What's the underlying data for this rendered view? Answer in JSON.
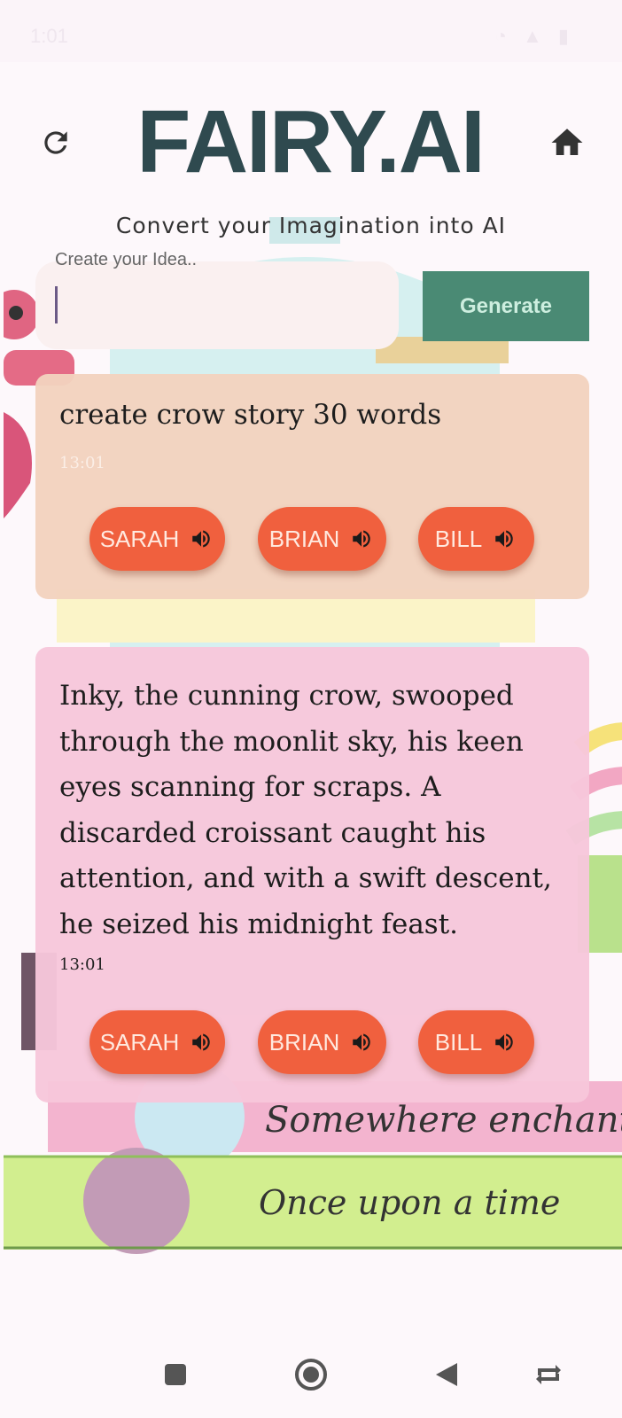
{
  "header": {
    "title": "FAIRY.AI",
    "subtitle": "Convert your Imagination into AI"
  },
  "input": {
    "label": "Create your Idea..",
    "value": "",
    "generate_label": "Generate"
  },
  "messages": [
    {
      "role": "user",
      "text": "create crow story 30 words",
      "time": "13:01",
      "voices": [
        "SARAH",
        "BRIAN",
        "BILL"
      ]
    },
    {
      "role": "ai",
      "text": "Inky, the cunning crow, swooped through the moonlit sky, his keen eyes scanning for scraps. A discarded croissant caught his attention, and with a swift descent, he seized his midnight feast.",
      "time": "13:01",
      "voices": [
        "SARAH",
        "BRIAN",
        "BILL"
      ]
    }
  ],
  "background": {
    "book_text_1": "Somewhere enchante",
    "book_text_2": "Once upon a time"
  },
  "colors": {
    "title": "#2f4a4f",
    "generate_button": "#4a8a74",
    "user_card": "#f2d2be",
    "ai_card": "#f7c7db",
    "voice_button": "#f0603e"
  },
  "icons": {
    "refresh": "refresh-icon",
    "home": "home-icon",
    "speaker": "volume-icon"
  }
}
